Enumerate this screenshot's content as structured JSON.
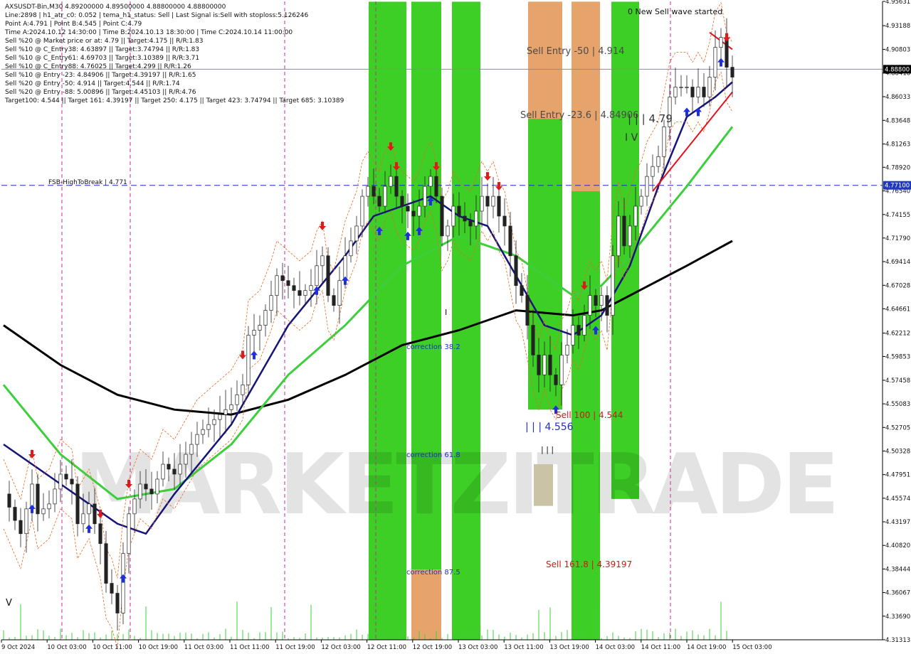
{
  "info": {
    "lines": [
      "AXSUSDT-Bin,M30  4.89200000 4.89500000 4.88800000 4.88800000",
      "Line:2898 | h1_atr_c0: 0.052 | tema_h1_status: Sell | Last Signal is:Sell with stoploss:5.126246",
      "Point A:4.791 | Point B:4.545 | Point C:4.79",
      "Time A:2024.10.12 14:30:00 | Time B:2024.10.13 18:30:00 | Time C:2024.10.14 11:00:00",
      "Sell %20 @ Market price or at: 4.79 || Target:4.175 || R/R:1.83",
      "Sell %10 @ C_Entry38: 4.63897 || Target:3.74794 || R/R:1.83",
      "Sell %10 @ C_Entry61: 4.69703 || Target:3.10389 || R/R:3.71",
      "Sell %10 @ C_Entry88: 4.76025 || Target:4.299 || R/R:1.26",
      "Sell %10 @ Entry -23: 4.84906 || Target:4.39197 || R/R:1.65",
      "Sell %20 @ Entry -50: 4.914 || Target:4.544 || R/R:1.74",
      "Sell %20 @ Entry -88: 5.00896 || Target:4.45103 || R/R:4.76",
      "Target100: 4.544 || Target 161: 4.39197 || Target 250: 4.175 || Target 423: 3.74794 || Target 685: 3.10389"
    ]
  },
  "labels": {
    "new_sell_wave": "0 New Sell wave started",
    "sell_entry_50": "Sell Entry -50 | 4.914",
    "sell_entry_236": "Sell Entry -23.6 | 4.84906",
    "wave_479": "| | | 4.79",
    "wave_iv": "I V",
    "fsb": "FSB-HighToBreak | 4.771",
    "correction_382": "correction 38.2",
    "correction_618": "correction 61.8",
    "correction_875": "correction 87.5",
    "sell_100": "Sell 100 | 4.544",
    "wave_4556": "| | | 4.556",
    "sell_1618": "Sell 161.8 | 4.39197",
    "wave_ticks": "| | |",
    "wave_v": "V",
    "wave_i": "I",
    "watermark": "MARKETZITRADE"
  },
  "chart_data": {
    "type": "candlestick",
    "symbol": "AXSUSDT-Bin",
    "timeframe": "M30",
    "ohlc_last": {
      "open": 4.892,
      "high": 4.895,
      "low": 4.888,
      "close": 4.888
    },
    "ylim": [
      4.3131,
      4.9563
    ],
    "y_ticks": [
      "4.95631",
      "4.93188",
      "4.90803",
      "4.88418",
      "4.86033",
      "4.83648",
      "4.81263",
      "4.78920",
      "4.76540",
      "4.74155",
      "4.71790",
      "4.69414",
      "4.67028",
      "4.64661",
      "4.62212",
      "4.59853",
      "4.57458",
      "4.55083",
      "4.52705",
      "4.50328",
      "4.47951",
      "4.45574",
      "4.43197",
      "4.40820",
      "4.38444",
      "4.36067",
      "4.33690",
      "4.31313"
    ],
    "x_ticks": [
      "9 Oct 2024",
      "10 Oct 03:00",
      "10 Oct 11:00",
      "10 Oct 19:00",
      "11 Oct 03:00",
      "11 Oct 11:00",
      "11 Oct 19:00",
      "12 Oct 03:00",
      "12 Oct 11:00",
      "12 Oct 19:00",
      "13 Oct 03:00",
      "13 Oct 11:00",
      "13 Oct 19:00",
      "14 Oct 03:00",
      "14 Oct 11:00",
      "14 Oct 19:00",
      "15 Oct 03:00"
    ],
    "price_labels": [
      {
        "value": 4.888,
        "text": "4.88800",
        "color": "#000000"
      },
      {
        "value": 4.771,
        "text": "4.77100",
        "color": "#2038c0"
      }
    ],
    "hlines": [
      {
        "value": 4.771,
        "color": "#1f2fbf",
        "style": "dashed"
      },
      {
        "value": 4.888,
        "color": "#8a8a9a",
        "style": "solid"
      }
    ],
    "close_path": [
      [
        0,
        4.46
      ],
      [
        3,
        4.42
      ],
      [
        5,
        4.47
      ],
      [
        6,
        4.44
      ],
      [
        8,
        4.45
      ],
      [
        10,
        4.48
      ],
      [
        12,
        4.47
      ],
      [
        13,
        4.43
      ],
      [
        15,
        4.45
      ],
      [
        17,
        4.41
      ],
      [
        18,
        4.37
      ],
      [
        19,
        4.36
      ],
      [
        20,
        4.34
      ],
      [
        21,
        4.4
      ],
      [
        22,
        4.44
      ],
      [
        24,
        4.47
      ],
      [
        26,
        4.46
      ],
      [
        28,
        4.49
      ],
      [
        30,
        4.48
      ],
      [
        32,
        4.5
      ],
      [
        34,
        4.52
      ],
      [
        36,
        4.53
      ],
      [
        38,
        4.54
      ],
      [
        40,
        4.55
      ],
      [
        42,
        4.57
      ],
      [
        43,
        4.62
      ],
      [
        45,
        4.63
      ],
      [
        47,
        4.66
      ],
      [
        48,
        4.68
      ],
      [
        50,
        4.67
      ],
      [
        52,
        4.66
      ],
      [
        54,
        4.67
      ],
      [
        55,
        4.69
      ],
      [
        56,
        4.7
      ],
      [
        57,
        4.66
      ],
      [
        58,
        4.65
      ],
      [
        60,
        4.7
      ],
      [
        62,
        4.73
      ],
      [
        63,
        4.76
      ],
      [
        64,
        4.77
      ],
      [
        65,
        4.76
      ],
      [
        66,
        4.75
      ],
      [
        67,
        4.77
      ],
      [
        68,
        4.78
      ],
      [
        69,
        4.76
      ],
      [
        70,
        4.75
      ],
      [
        72,
        4.74
      ],
      [
        73,
        4.75
      ],
      [
        74,
        4.77
      ],
      [
        75,
        4.78
      ],
      [
        76,
        4.76
      ],
      [
        77,
        4.72
      ],
      [
        78,
        4.73
      ],
      [
        79,
        4.75
      ],
      [
        80,
        4.74
      ],
      [
        82,
        4.73
      ],
      [
        84,
        4.76
      ],
      [
        85,
        4.75
      ],
      [
        86,
        4.76
      ],
      [
        87,
        4.74
      ],
      [
        88,
        4.73
      ],
      [
        89,
        4.7
      ],
      [
        90,
        4.67
      ],
      [
        91,
        4.66
      ],
      [
        92,
        4.63
      ],
      [
        93,
        4.6
      ],
      [
        94,
        4.58
      ],
      [
        95,
        4.6
      ],
      [
        96,
        4.58
      ],
      [
        97,
        4.57
      ],
      [
        98,
        4.6
      ],
      [
        99,
        4.61
      ],
      [
        100,
        4.63
      ],
      [
        101,
        4.62
      ],
      [
        102,
        4.64
      ],
      [
        103,
        4.66
      ],
      [
        104,
        4.65
      ],
      [
        105,
        4.66
      ],
      [
        106,
        4.64
      ],
      [
        107,
        4.7
      ],
      [
        108,
        4.74
      ],
      [
        109,
        4.71
      ],
      [
        110,
        4.73
      ],
      [
        111,
        4.75
      ],
      [
        112,
        4.76
      ],
      [
        113,
        4.78
      ],
      [
        114,
        4.79
      ],
      [
        115,
        4.8
      ],
      [
        116,
        4.83
      ],
      [
        117,
        4.86
      ],
      [
        118,
        4.87
      ],
      [
        119,
        4.87
      ],
      [
        120,
        4.87
      ],
      [
        121,
        4.86
      ],
      [
        122,
        4.87
      ],
      [
        123,
        4.86
      ],
      [
        124,
        4.88
      ],
      [
        125,
        4.91
      ],
      [
        126,
        4.92
      ],
      [
        127,
        4.89
      ],
      [
        128,
        4.88
      ]
    ],
    "ma_black": [
      [
        0,
        4.63
      ],
      [
        10,
        4.59
      ],
      [
        20,
        4.56
      ],
      [
        30,
        4.545
      ],
      [
        40,
        4.54
      ],
      [
        50,
        4.555
      ],
      [
        60,
        4.58
      ],
      [
        70,
        4.61
      ],
      [
        80,
        4.625
      ],
      [
        90,
        4.645
      ],
      [
        100,
        4.64
      ],
      [
        105,
        4.645
      ],
      [
        110,
        4.66
      ],
      [
        120,
        4.69
      ],
      [
        128,
        4.715
      ]
    ],
    "ma_green": [
      [
        0,
        4.57
      ],
      [
        10,
        4.5
      ],
      [
        20,
        4.455
      ],
      [
        30,
        4.465
      ],
      [
        40,
        4.51
      ],
      [
        50,
        4.58
      ],
      [
        60,
        4.63
      ],
      [
        70,
        4.69
      ],
      [
        80,
        4.72
      ],
      [
        90,
        4.7
      ],
      [
        100,
        4.66
      ],
      [
        105,
        4.67
      ],
      [
        110,
        4.7
      ],
      [
        120,
        4.77
      ],
      [
        128,
        4.83
      ]
    ],
    "ma_navy": [
      [
        0,
        4.51
      ],
      [
        10,
        4.47
      ],
      [
        20,
        4.43
      ],
      [
        25,
        4.42
      ],
      [
        30,
        4.46
      ],
      [
        40,
        4.53
      ],
      [
        50,
        4.63
      ],
      [
        60,
        4.7
      ],
      [
        65,
        4.74
      ],
      [
        70,
        4.75
      ],
      [
        75,
        4.76
      ],
      [
        80,
        4.74
      ],
      [
        85,
        4.73
      ],
      [
        90,
        4.68
      ],
      [
        95,
        4.63
      ],
      [
        100,
        4.62
      ],
      [
        105,
        4.64
      ],
      [
        110,
        4.69
      ],
      [
        115,
        4.77
      ],
      [
        120,
        4.84
      ],
      [
        125,
        4.86
      ],
      [
        128,
        4.875
      ]
    ],
    "trendline_red": [
      [
        114,
        4.765
      ],
      [
        128,
        4.865
      ]
    ],
    "trendline_red_top": [
      [
        124,
        4.925
      ],
      [
        128,
        4.908
      ]
    ],
    "zones": [
      {
        "x0": 518,
        "x1": 571,
        "y0": 4.956,
        "y1": 4.313,
        "color": "#33cc1a"
      },
      {
        "x0": 578,
        "x1": 620,
        "y0": 4.956,
        "y1": 4.313,
        "color": "#33cc1a"
      },
      {
        "x0": 635,
        "x1": 675,
        "y0": 4.956,
        "y1": 4.313,
        "color": "#33cc1a"
      },
      {
        "x0": 742,
        "x1": 790,
        "y0": 4.956,
        "y1": 4.545,
        "color": "#33cc1a"
      },
      {
        "x0": 803,
        "x1": 843,
        "y0": 4.956,
        "y1": 4.313,
        "color": "#33cc1a"
      },
      {
        "x0": 859,
        "x1": 898,
        "y0": 4.956,
        "y1": 4.455,
        "color": "#33cc1a"
      },
      {
        "x0": 742,
        "x1": 790,
        "y0": 4.956,
        "y1": 4.838,
        "color": "#f0a070"
      },
      {
        "x0": 803,
        "x1": 843,
        "y0": 4.956,
        "y1": 4.765,
        "color": "#f0a070"
      },
      {
        "x0": 578,
        "x1": 620,
        "y0": 4.384,
        "y1": 4.313,
        "color": "#f0a070"
      },
      {
        "x0": 750,
        "x1": 777,
        "y0": 4.49,
        "y1": 4.448,
        "color": "#c8c0a0"
      }
    ],
    "magenta_vlines": [
      87,
      183,
      400,
      528,
      942
    ]
  }
}
